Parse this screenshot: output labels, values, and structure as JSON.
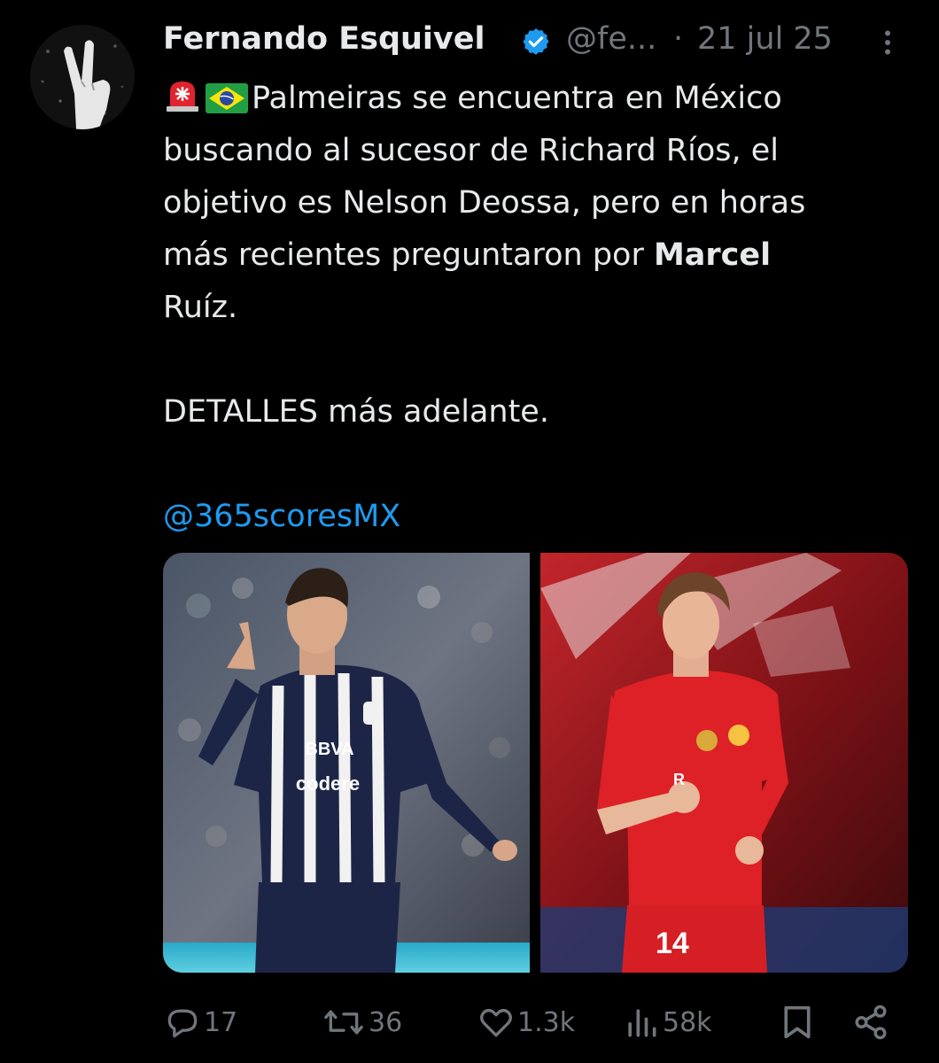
{
  "tweet": {
    "author": {
      "name": "Fernando Esquivel",
      "handle": "@fe...",
      "separator": "·",
      "verified": true,
      "avatar_icon": "peace-hand-avatar"
    },
    "date": "21 jul 25",
    "text_lines": [
      "Palmeiras se encuentra en México",
      "buscando al sucesor de Richard Ríos, el",
      "objetivo es Nelson Deossa, pero en horas",
      "más recientes preguntaron por ",
      "Marcel",
      "Ruíz.",
      "DETALLES más adelante."
    ],
    "emojis": [
      "rotating-light-emoji",
      "brazil-flag-emoji"
    ],
    "mention": "@365scoresMX",
    "media": [
      {
        "icon": "photo-player-monterrey",
        "jersey_text": [
          "BBVA",
          "codere"
        ]
      },
      {
        "icon": "photo-player-toluca",
        "jersey_number": "14"
      }
    ],
    "stats": {
      "replies": "17",
      "retweets": "36",
      "likes": "1.3k",
      "views": "58k"
    }
  },
  "colors": {
    "background": "#000000",
    "text": "#e7e9ea",
    "muted": "#71767b",
    "link": "#1d9bf0",
    "verified": "#1d9bf0"
  }
}
